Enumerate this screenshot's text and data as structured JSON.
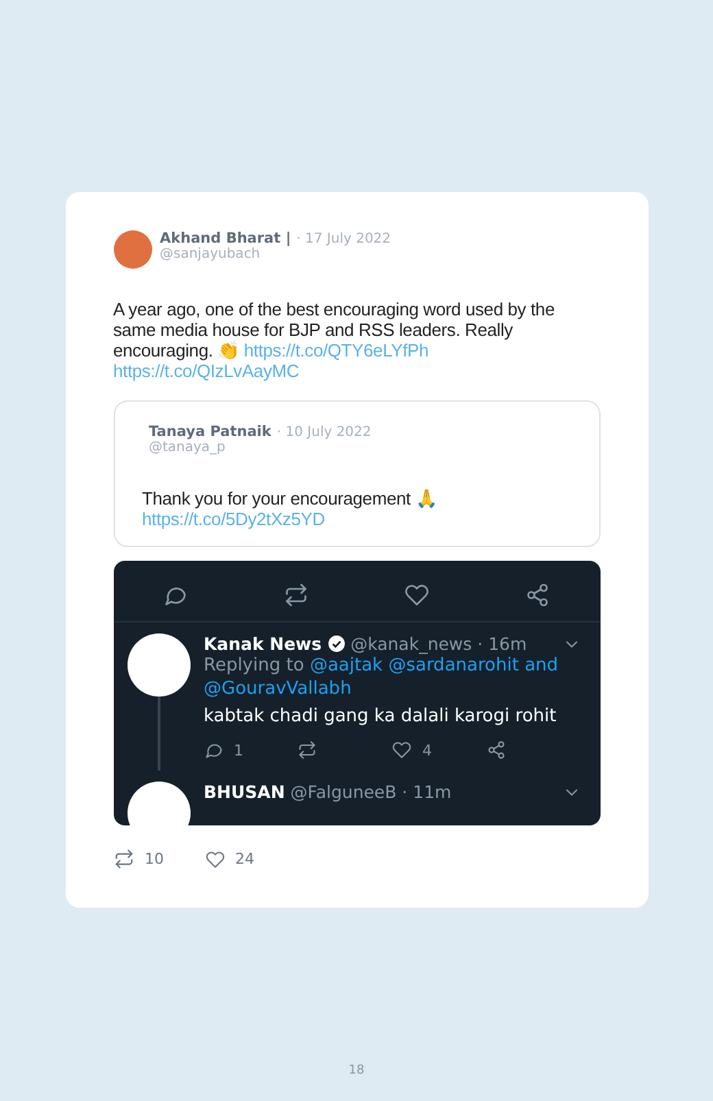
{
  "tweet": {
    "author": "Akhand Bharat |",
    "date": "· 17 July 2022",
    "handle": "@sanjayubach",
    "text": "A year ago, one of the best encouraging word used by the same media house for BJP and RSS leaders. Really encouraging. 👏",
    "links": [
      "https://t.co/QTY6eLYfPh",
      "https://t.co/QIzLvAayMC"
    ],
    "quote": {
      "author": "Tanaya Patnaik",
      "date": "· 10 July 2022",
      "handle": "@tanaya_p",
      "text": "Thank you for your encouragement 🙏",
      "link": "https://t.co/5Dy2tXz5YD"
    },
    "screenshot": {
      "replies": [
        {
          "name": "Kanak News",
          "verified": true,
          "handle": "@kanak_news · 16m",
          "replying_label": "Replying to",
          "replying_to": "@aajtak @sardanarohit and @GouravVallabh",
          "text": "kabtak chadi gang ka dalali karogi rohit",
          "reply_count": "1",
          "like_count": "4"
        },
        {
          "name": "BHUSAN",
          "verified": false,
          "handle": "@FalguneeB · 11m"
        }
      ]
    },
    "retweets": "10",
    "likes": "24"
  },
  "page_number": "18"
}
